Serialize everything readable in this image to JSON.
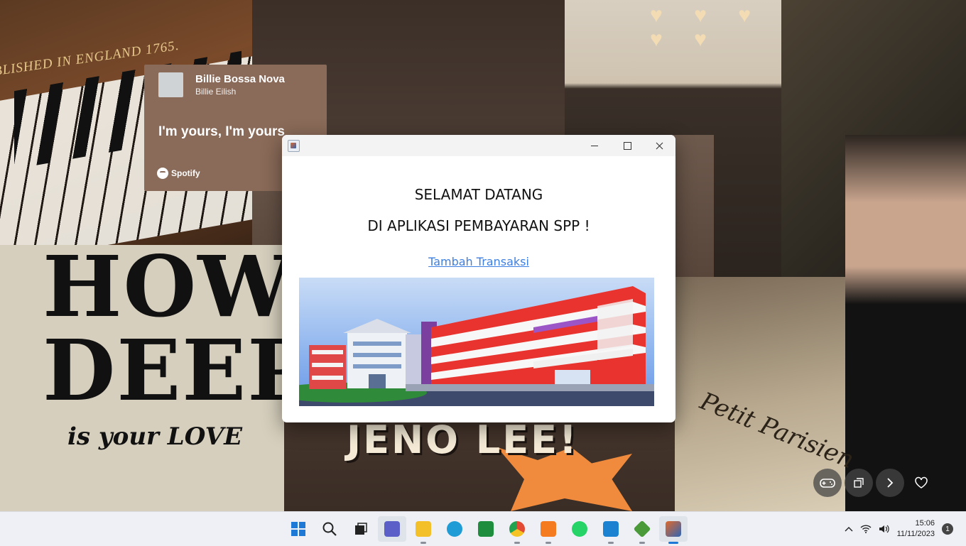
{
  "wallpaper": {
    "engraving": "BLISHED IN ENGLAND 1765.",
    "how_deep": "HOW DEEP",
    "is_your_love": "is your LOVE",
    "jeno": "JENO LEE!",
    "petit": "Petit Parisien",
    "spotify_card": {
      "song": "Billie Bossa Nova",
      "artist": "Billie Eilish",
      "lyric": "I'm yours, I'm yours",
      "brand": "Spotify"
    }
  },
  "window": {
    "welcome_line1": "SELAMAT DATANG",
    "welcome_line2": "DI APLIKASI PEMBAYARAN SPP !",
    "link_label": "Tambah Transaksi",
    "banner_icon": "school-building-illustration"
  },
  "floating_actions": [
    {
      "icon": "gamepad-icon"
    },
    {
      "icon": "copy-icon"
    },
    {
      "icon": "chevron-right-icon"
    },
    {
      "icon": "heart-icon"
    }
  ],
  "taskbar": {
    "apps": [
      {
        "name": "start",
        "icon": "windows-icon",
        "color": "#1e78d6"
      },
      {
        "name": "search",
        "icon": "search-icon",
        "color": "#222222"
      },
      {
        "name": "task-view",
        "icon": "task-view-icon",
        "color": "#222222"
      },
      {
        "name": "meet",
        "icon": "video-call-icon",
        "color": "#5b5fc7"
      },
      {
        "name": "file-explorer",
        "icon": "folder-icon",
        "color": "#f3c02a"
      },
      {
        "name": "edge",
        "icon": "edge-icon",
        "color": "#1f9bd6"
      },
      {
        "name": "classroom",
        "icon": "classroom-icon",
        "color": "#1e8e3e"
      },
      {
        "name": "chrome",
        "icon": "chrome-icon",
        "color": "#e24a33"
      },
      {
        "name": "xampp",
        "icon": "xampp-icon",
        "color": "#f47b20"
      },
      {
        "name": "whatsapp",
        "icon": "whatsapp-icon",
        "color": "#25d366"
      },
      {
        "name": "vscode",
        "icon": "vscode-icon",
        "color": "#1b82d1"
      },
      {
        "name": "netbeans",
        "icon": "netbeans-icon",
        "color": "#4a9a3a"
      },
      {
        "name": "java",
        "icon": "java-icon",
        "color": "#e0682a"
      }
    ],
    "time": "15:06",
    "date": "11/11/2023",
    "notification_count": "1"
  }
}
